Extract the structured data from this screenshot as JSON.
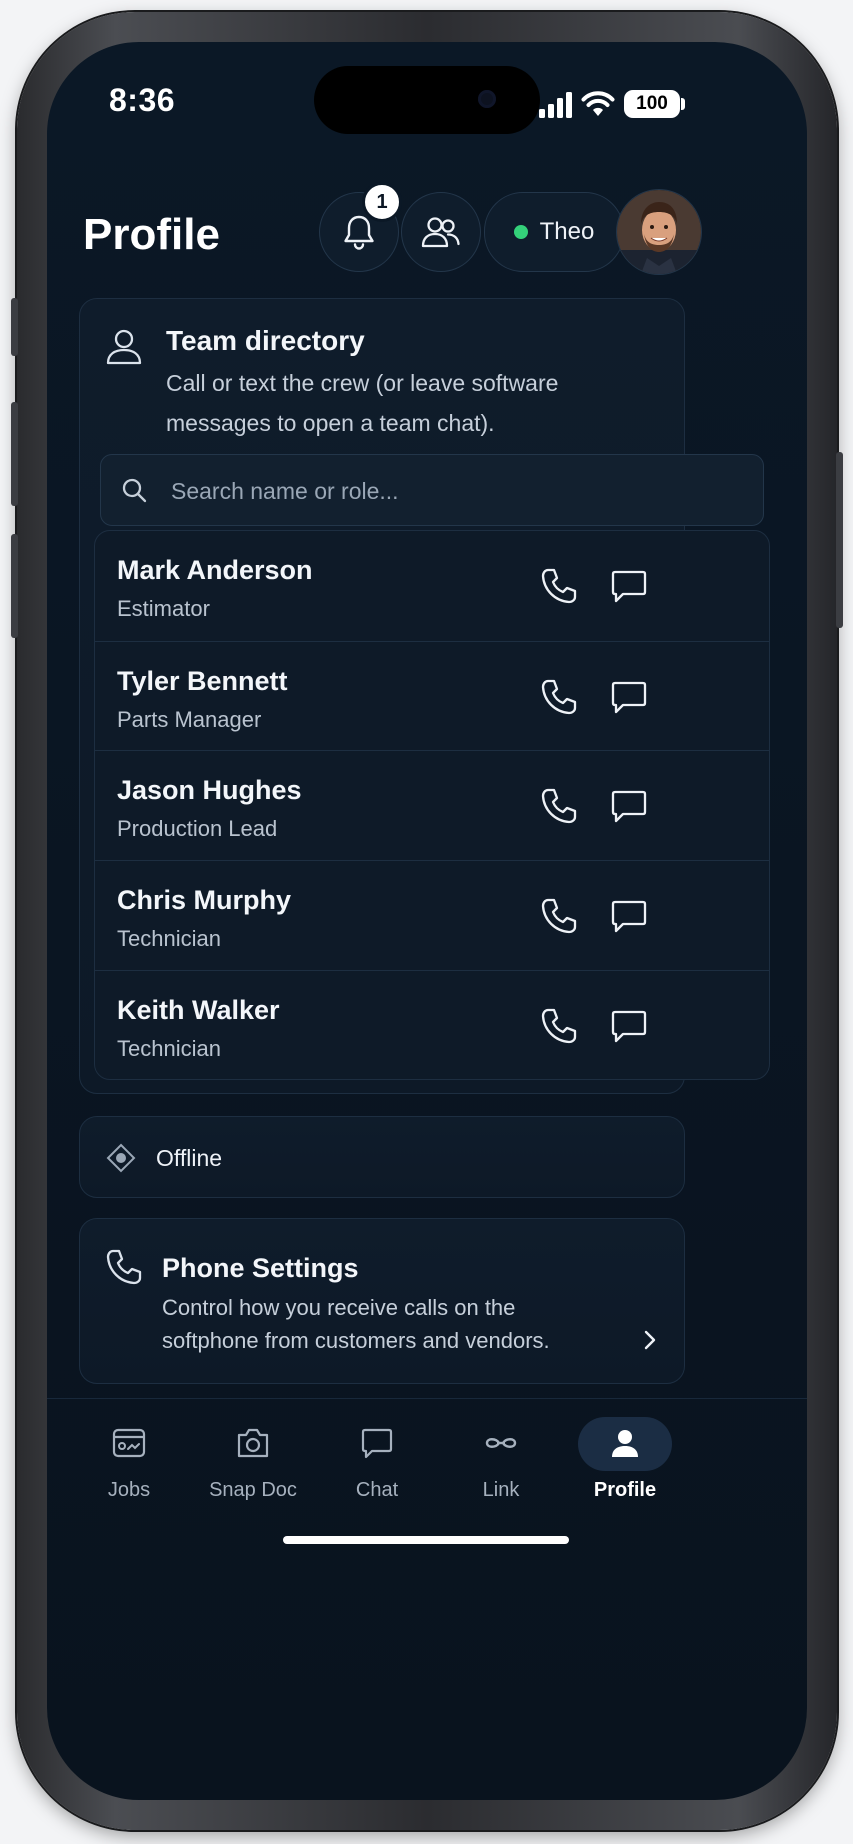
{
  "status_bar": {
    "time": "8:36",
    "battery": "100"
  },
  "header": {
    "title": "Profile",
    "notification_count": "1",
    "status_name": "Theo",
    "status_color": "#34d17a"
  },
  "team_directory": {
    "title": "Team directory",
    "description": "Call or text the crew (or leave software messages to open a team chat).",
    "search_placeholder": "Search name or role...",
    "members": [
      {
        "name": "Mark Anderson",
        "role": "Estimator"
      },
      {
        "name": "Tyler Bennett",
        "role": "Parts Manager"
      },
      {
        "name": "Jason Hughes",
        "role": "Production Lead"
      },
      {
        "name": "Chris Murphy",
        "role": "Technician"
      },
      {
        "name": "Keith Walker",
        "role": "Technician"
      }
    ]
  },
  "offline": {
    "label": "Offline"
  },
  "phone_settings": {
    "title": "Phone Settings",
    "description": "Control how you receive calls on the softphone from customers and vendors."
  },
  "tabs": [
    {
      "label": "Jobs",
      "icon": "jobs-icon"
    },
    {
      "label": "Snap Doc",
      "icon": "camera-icon"
    },
    {
      "label": "Chat",
      "icon": "chat-icon"
    },
    {
      "label": "Link",
      "icon": "link-icon"
    },
    {
      "label": "Profile",
      "icon": "profile-icon",
      "active": true
    }
  ],
  "colors": {
    "background": "#0a1522",
    "card": "#0f1c2b",
    "accent": "#1b2d44"
  }
}
